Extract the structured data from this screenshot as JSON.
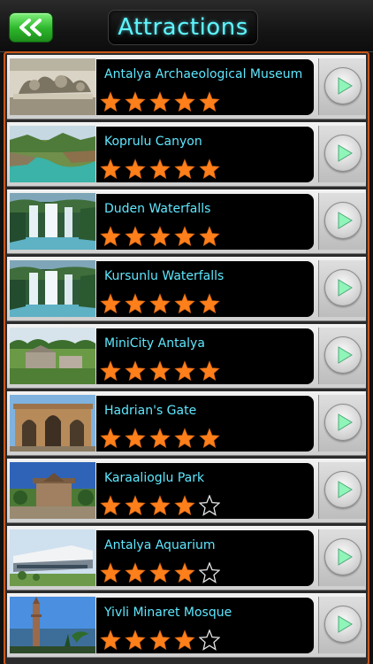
{
  "header": {
    "back_icon": "double-chevron-left-icon",
    "title": "Attractions",
    "accent_color": "#5ff5ff"
  },
  "list": {
    "star_color": "#ff7f1a",
    "items": [
      {
        "name": "Antalya Archaeological Museum",
        "rating": 5,
        "thumb": "archaeological-museum-photo"
      },
      {
        "name": "Koprulu Canyon",
        "rating": 5,
        "thumb": "canyon-photo"
      },
      {
        "name": "Duden Waterfalls",
        "rating": 5,
        "thumb": "waterfall-photo"
      },
      {
        "name": "Kursunlu Waterfalls",
        "rating": 5,
        "thumb": "waterfall-photo"
      },
      {
        "name": "MiniCity Antalya",
        "rating": 5,
        "thumb": "miniature-park-photo"
      },
      {
        "name": "Hadrian's Gate",
        "rating": 5,
        "thumb": "roman-gate-photo"
      },
      {
        "name": "Karaalioglu Park",
        "rating": 4,
        "thumb": "tower-park-photo"
      },
      {
        "name": "Antalya Aquarium",
        "rating": 4,
        "thumb": "aquarium-building-photo"
      },
      {
        "name": "Yivli Minaret Mosque",
        "rating": 4,
        "thumb": "minaret-photo"
      }
    ]
  }
}
